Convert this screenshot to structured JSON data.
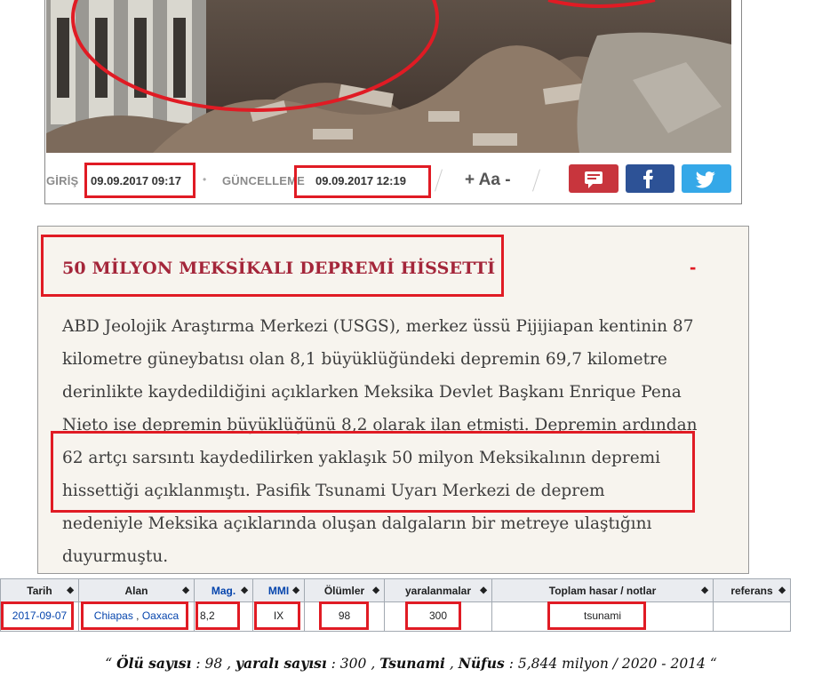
{
  "meta": {
    "entry_label": "GİRİŞ",
    "entry_date": "09.09.2017 09:17",
    "separator_dot": "•",
    "updated_label": "GÜNCELLEME",
    "updated_date": "09.09.2017 12:19",
    "font_size_control": "+ Aa -"
  },
  "share": {
    "comment_icon": "comment-icon",
    "facebook_icon": "facebook-icon",
    "twitter_icon": "twitter-icon",
    "colors": {
      "comment": "#c8353d",
      "facebook": "#2d5296",
      "twitter": "#35a8e8"
    }
  },
  "article": {
    "title": "50 MİLYON MEKSİKALI DEPREMİ HİSSETTİ",
    "marker": "-",
    "lines": [
      "ABD Jeolojik Araştırma Merkezi (USGS), merkez üssü Pijijiapan kentinin 87",
      "kilometre güneybatısı olan 8,1 büyüklüğündeki depremin 69,7 kilometre",
      "derinlikte kaydedildiğini açıklarken Meksika Devlet Başkanı Enrique Pena",
      "Nieto ise depremin büyüklüğünü 8,2 olarak ilan etmişti. Depremin ardından",
      "62 artçı sarsıntı kaydedilirken yaklaşık 50 milyon Meksikalının depremi",
      "hissettiği açıklanmıştı. Pasifik Tsunami Uyarı Merkezi de deprem",
      "nedeniyle Meksika açıklarında oluşan dalgaların bir metreye ulaştığını",
      "duyurmuştu."
    ]
  },
  "table": {
    "headers": [
      "Tarih",
      "Alan",
      "Mag.",
      "MMI",
      "Ölümler",
      "yaralanmalar",
      "Toplam hasar / notlar",
      "referans"
    ],
    "sort_icon": "◆",
    "row": {
      "date": "2017-09-07",
      "area_1": "Chiapas",
      "area_sep": " , ",
      "area_2": "Oaxaca",
      "mag": "8,2",
      "mmi": "IX",
      "deaths": "98",
      "injuries": "300",
      "notes": "tsunami",
      "refs": ""
    }
  },
  "caption": {
    "open_quote": "“ ",
    "k1": "Ölü sayısı",
    "v1": " : 98 , ",
    "k2": "yaralı sayısı",
    "v2": " : 300 , ",
    "k3": "Tsunami",
    "v3": " , ",
    "k4": "Nüfus",
    "v4": " : 5,844 milyon / 2020 - 2014 “"
  }
}
